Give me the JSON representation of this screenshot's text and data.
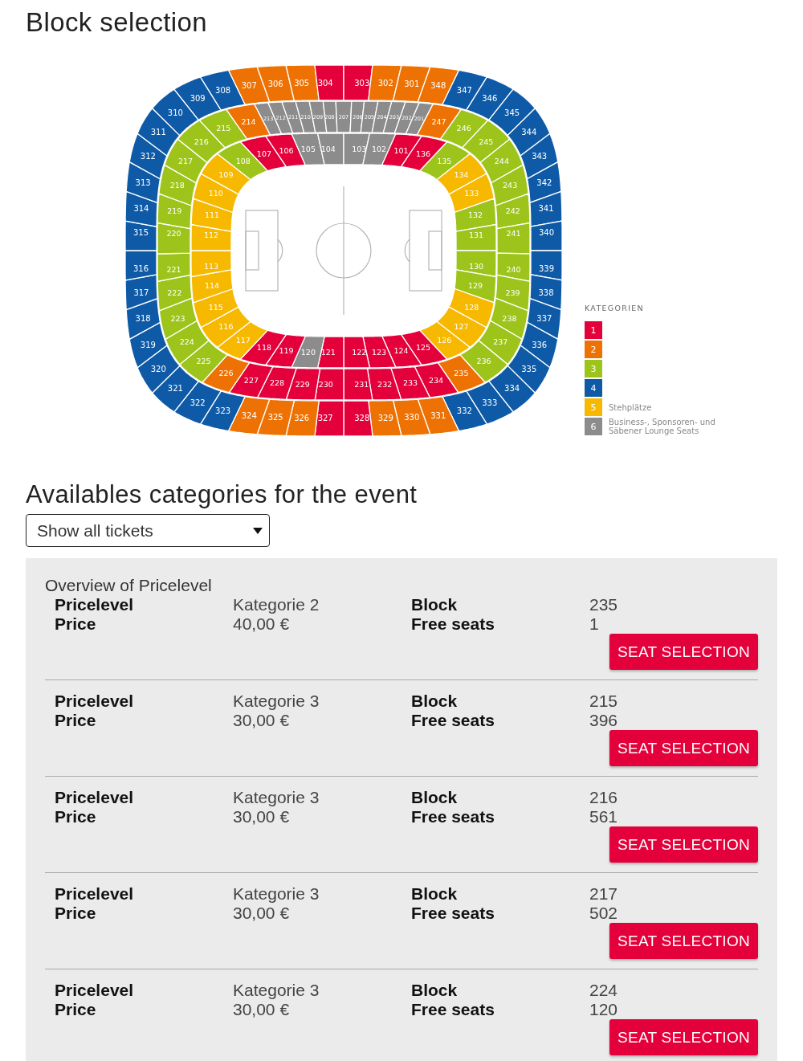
{
  "title": "Block selection",
  "stadium": {
    "rings": [
      {
        "top": [
          {
            "label": "107",
            "color": "#e3003b"
          },
          {
            "label": "106",
            "color": "#e3003b"
          },
          {
            "label": "105",
            "color": "#8c8c8c"
          },
          {
            "label": "104",
            "color": "#8c8c8c"
          },
          {
            "label": "103",
            "color": "#8c8c8c"
          },
          {
            "label": "102",
            "color": "#8c8c8c"
          },
          {
            "label": "101",
            "color": "#e3003b"
          },
          {
            "label": "136",
            "color": "#e3003b"
          }
        ],
        "right": [
          {
            "label": "135",
            "color": "#9dc41a"
          },
          {
            "label": "134",
            "color": "#f7b800"
          },
          {
            "label": "133",
            "color": "#f7b800"
          },
          {
            "label": "132",
            "color": "#9dc41a"
          },
          {
            "label": "131",
            "color": "#9dc41a"
          },
          {
            "label": "130",
            "color": "#9dc41a"
          },
          {
            "label": "129",
            "color": "#9dc41a"
          },
          {
            "label": "128",
            "color": "#f7b800"
          },
          {
            "label": "127",
            "color": "#f7b800"
          },
          {
            "label": "126",
            "color": "#f7b800"
          }
        ],
        "bottom": [
          {
            "label": "118",
            "color": "#e3003b"
          },
          {
            "label": "119",
            "color": "#e3003b"
          },
          {
            "label": "120",
            "color": "#8c8c8c"
          },
          {
            "label": "121",
            "color": "#e3003b"
          },
          {
            "label": "122",
            "color": "#e3003b"
          },
          {
            "label": "123",
            "color": "#e3003b"
          },
          {
            "label": "124",
            "color": "#e3003b"
          },
          {
            "label": "125",
            "color": "#e3003b"
          }
        ],
        "left": [
          {
            "label": "108",
            "color": "#9dc41a"
          },
          {
            "label": "109",
            "color": "#f7b800"
          },
          {
            "label": "110",
            "color": "#f7b800"
          },
          {
            "label": "111",
            "color": "#f7b800"
          },
          {
            "label": "112",
            "color": "#f7b800"
          },
          {
            "label": "113",
            "color": "#f7b800"
          },
          {
            "label": "114",
            "color": "#f7b800"
          },
          {
            "label": "115",
            "color": "#f7b800"
          },
          {
            "label": "116",
            "color": "#f7b800"
          },
          {
            "label": "117",
            "color": "#f7b800"
          }
        ]
      },
      {
        "top": [
          {
            "label": "214",
            "color": "#ee7203",
            "kind": "wide"
          },
          {
            "label": "213",
            "color": "#8c8c8c",
            "kind": "narrow"
          },
          {
            "label": "212",
            "color": "#8c8c8c",
            "kind": "narrow"
          },
          {
            "label": "211",
            "color": "#8c8c8c",
            "kind": "narrow"
          },
          {
            "label": "210",
            "color": "#8c8c8c",
            "kind": "narrow"
          },
          {
            "label": "209",
            "color": "#8c8c8c",
            "kind": "narrow"
          },
          {
            "label": "208",
            "color": "#8c8c8c",
            "kind": "narrow"
          },
          {
            "label": "207",
            "color": "#8c8c8c",
            "kind": "narrow"
          },
          {
            "label": "206",
            "color": "#8c8c8c",
            "kind": "narrow"
          },
          {
            "label": "205",
            "color": "#8c8c8c",
            "kind": "narrow"
          },
          {
            "label": "204",
            "color": "#8c8c8c",
            "kind": "narrow"
          },
          {
            "label": "203",
            "color": "#8c8c8c",
            "kind": "narrow"
          },
          {
            "label": "202",
            "color": "#8c8c8c",
            "kind": "narrow"
          },
          {
            "label": "201",
            "color": "#8c8c8c",
            "kind": "narrow"
          },
          {
            "label": "247",
            "color": "#ee7203",
            "kind": "wide"
          }
        ],
        "right": [
          {
            "label": "246",
            "color": "#9dc41a",
            "kind": "wide"
          },
          {
            "label": "245",
            "color": "#9dc41a",
            "kind": "wide"
          },
          {
            "label": "244",
            "color": "#9dc41a",
            "kind": "wide"
          },
          {
            "label": "243",
            "color": "#9dc41a",
            "kind": "wide"
          },
          {
            "label": "242",
            "color": "#9dc41a",
            "kind": "wide"
          },
          {
            "label": "241",
            "color": "#9dc41a",
            "kind": "wide"
          },
          {
            "label": "240",
            "color": "#9dc41a",
            "kind": "wide"
          },
          {
            "label": "239",
            "color": "#9dc41a",
            "kind": "wide"
          },
          {
            "label": "238",
            "color": "#9dc41a",
            "kind": "wide"
          },
          {
            "label": "237",
            "color": "#9dc41a",
            "kind": "wide"
          },
          {
            "label": "236",
            "color": "#9dc41a",
            "kind": "wide"
          },
          {
            "label": "235",
            "color": "#ee7203",
            "kind": "wide"
          }
        ],
        "bottom": [
          {
            "label": "227",
            "color": "#e3003b",
            "kind": "wide"
          },
          {
            "label": "228",
            "color": "#e3003b",
            "kind": "wide"
          },
          {
            "label": "229",
            "color": "#e3003b",
            "kind": "wide"
          },
          {
            "label": "230",
            "color": "#e3003b",
            "kind": "wide"
          },
          {
            "label": "231",
            "color": "#e3003b",
            "kind": "wide"
          },
          {
            "label": "232",
            "color": "#e3003b",
            "kind": "wide"
          },
          {
            "label": "233",
            "color": "#e3003b",
            "kind": "wide"
          },
          {
            "label": "234",
            "color": "#e3003b",
            "kind": "wide"
          }
        ],
        "left": [
          {
            "label": "215",
            "color": "#9dc41a",
            "kind": "wide"
          },
          {
            "label": "216",
            "color": "#9dc41a",
            "kind": "wide"
          },
          {
            "label": "217",
            "color": "#9dc41a",
            "kind": "wide"
          },
          {
            "label": "218",
            "color": "#9dc41a",
            "kind": "wide"
          },
          {
            "label": "219",
            "color": "#9dc41a",
            "kind": "wide"
          },
          {
            "label": "220",
            "color": "#9dc41a",
            "kind": "wide"
          },
          {
            "label": "221",
            "color": "#9dc41a",
            "kind": "wide"
          },
          {
            "label": "222",
            "color": "#9dc41a",
            "kind": "wide"
          },
          {
            "label": "223",
            "color": "#9dc41a",
            "kind": "wide"
          },
          {
            "label": "224",
            "color": "#9dc41a",
            "kind": "wide"
          },
          {
            "label": "225",
            "color": "#9dc41a",
            "kind": "wide"
          },
          {
            "label": "226",
            "color": "#ee7203",
            "kind": "wide"
          }
        ]
      },
      {
        "top": [
          {
            "label": "307",
            "color": "#ee7203"
          },
          {
            "label": "306",
            "color": "#ee7203"
          },
          {
            "label": "305",
            "color": "#ee7203"
          },
          {
            "label": "304",
            "color": "#e3003b"
          },
          {
            "label": "303",
            "color": "#e3003b"
          },
          {
            "label": "302",
            "color": "#ee7203"
          },
          {
            "label": "301",
            "color": "#ee7203"
          },
          {
            "label": "348",
            "color": "#ee7203"
          }
        ],
        "right": [
          {
            "label": "347",
            "color": "#0e5aa7"
          },
          {
            "label": "346",
            "color": "#0e5aa7"
          },
          {
            "label": "345",
            "color": "#0e5aa7"
          },
          {
            "label": "344",
            "color": "#0e5aa7"
          },
          {
            "label": "343",
            "color": "#0e5aa7"
          },
          {
            "label": "342",
            "color": "#0e5aa7"
          },
          {
            "label": "341",
            "color": "#0e5aa7"
          },
          {
            "label": "340",
            "color": "#0e5aa7"
          },
          {
            "label": "339",
            "color": "#0e5aa7"
          },
          {
            "label": "338",
            "color": "#0e5aa7"
          },
          {
            "label": "337",
            "color": "#0e5aa7"
          },
          {
            "label": "336",
            "color": "#0e5aa7"
          },
          {
            "label": "335",
            "color": "#0e5aa7"
          },
          {
            "label": "334",
            "color": "#0e5aa7"
          },
          {
            "label": "333",
            "color": "#0e5aa7"
          },
          {
            "label": "332",
            "color": "#0e5aa7"
          }
        ],
        "bottom": [
          {
            "label": "324",
            "color": "#ee7203"
          },
          {
            "label": "325",
            "color": "#ee7203"
          },
          {
            "label": "326",
            "color": "#ee7203"
          },
          {
            "label": "327",
            "color": "#e3003b"
          },
          {
            "label": "328",
            "color": "#e3003b"
          },
          {
            "label": "329",
            "color": "#ee7203"
          },
          {
            "label": "330",
            "color": "#ee7203"
          },
          {
            "label": "331",
            "color": "#ee7203"
          }
        ],
        "left": [
          {
            "label": "308",
            "color": "#0e5aa7"
          },
          {
            "label": "309",
            "color": "#0e5aa7"
          },
          {
            "label": "310",
            "color": "#0e5aa7"
          },
          {
            "label": "311",
            "color": "#0e5aa7"
          },
          {
            "label": "312",
            "color": "#0e5aa7"
          },
          {
            "label": "313",
            "color": "#0e5aa7"
          },
          {
            "label": "314",
            "color": "#0e5aa7"
          },
          {
            "label": "315",
            "color": "#0e5aa7"
          },
          {
            "label": "316",
            "color": "#0e5aa7"
          },
          {
            "label": "317",
            "color": "#0e5aa7"
          },
          {
            "label": "318",
            "color": "#0e5aa7"
          },
          {
            "label": "319",
            "color": "#0e5aa7"
          },
          {
            "label": "320",
            "color": "#0e5aa7"
          },
          {
            "label": "321",
            "color": "#0e5aa7"
          },
          {
            "label": "322",
            "color": "#0e5aa7"
          },
          {
            "label": "323",
            "color": "#0e5aa7"
          }
        ]
      }
    ],
    "legend": {
      "title": "KATEGORIEN",
      "items": [
        {
          "number": "1",
          "color": "#e3003b"
        },
        {
          "number": "2",
          "color": "#ee7203"
        },
        {
          "number": "3",
          "color": "#9dc41a"
        },
        {
          "number": "4",
          "color": "#0e5aa7"
        },
        {
          "number": "5",
          "color": "#f7b800",
          "label": "Stehplätze"
        },
        {
          "number": "6",
          "color": "#8c8c8c",
          "label": "Business-, Sponsoren- und Säbener Lounge Seats"
        }
      ]
    }
  },
  "categories": {
    "title": "Availables categories for the event",
    "filter": {
      "value": "Show all tickets"
    },
    "overview_title": "Overview of Pricelevel",
    "rows": [
      {
        "pricelevel_label": "Pricelevel",
        "pricelevel": "Kategorie 2",
        "price_label": "Price",
        "price": "40,00 €",
        "block_label": "Block",
        "block": "235",
        "free_seats_label": "Free seats",
        "free_seats": "1",
        "button": "SEAT SELECTION"
      },
      {
        "pricelevel_label": "Pricelevel",
        "pricelevel": "Kategorie 3",
        "price_label": "Price",
        "price": "30,00 €",
        "block_label": "Block",
        "block": "215",
        "free_seats_label": "Free seats",
        "free_seats": "396",
        "button": "SEAT SELECTION"
      },
      {
        "pricelevel_label": "Pricelevel",
        "pricelevel": "Kategorie 3",
        "price_label": "Price",
        "price": "30,00 €",
        "block_label": "Block",
        "block": "216",
        "free_seats_label": "Free seats",
        "free_seats": "561",
        "button": "SEAT SELECTION"
      },
      {
        "pricelevel_label": "Pricelevel",
        "pricelevel": "Kategorie 3",
        "price_label": "Price",
        "price": "30,00 €",
        "block_label": "Block",
        "block": "217",
        "free_seats_label": "Free seats",
        "free_seats": "502",
        "button": "SEAT SELECTION"
      },
      {
        "pricelevel_label": "Pricelevel",
        "pricelevel": "Kategorie 3",
        "price_label": "Price",
        "price": "30,00 €",
        "block_label": "Block",
        "block": "224",
        "free_seats_label": "Free seats",
        "free_seats": "120",
        "button": "SEAT SELECTION"
      }
    ]
  }
}
